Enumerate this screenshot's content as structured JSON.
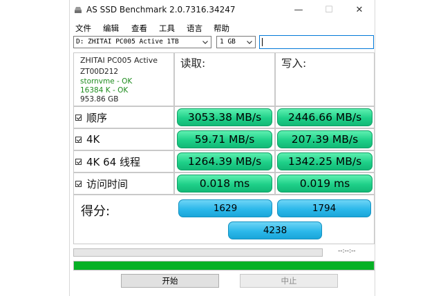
{
  "window": {
    "title": "AS SSD Benchmark 2.0.7316.34247"
  },
  "controls": {
    "minimize": "—",
    "maximize": "☐",
    "close": "✕"
  },
  "menu": [
    "文件",
    "编辑",
    "查看",
    "工具",
    "语言",
    "帮助"
  ],
  "drive": {
    "selected": "D: ZHITAI PC005 Active 1TB"
  },
  "size": {
    "selected": "1 GB"
  },
  "search": {
    "value": ""
  },
  "info": {
    "model": "ZHITAI PC005 Active",
    "firmware": "ZT00D212",
    "driver": "stornvme - OK",
    "alignment": "16384 K - OK",
    "capacity": "953.86 GB"
  },
  "headers": {
    "read": "读取:",
    "write": "写入:"
  },
  "tests": [
    {
      "label": "顺序",
      "read": "3053.38 MB/s",
      "write": "2446.66 MB/s",
      "checked": true
    },
    {
      "label": "4K",
      "read": "59.71 MB/s",
      "write": "207.39 MB/s",
      "checked": true
    },
    {
      "label": "4K 64 线程",
      "read": "1264.39 MB/s",
      "write": "1342.25 MB/s",
      "checked": true
    },
    {
      "label": "访问时间",
      "read": "0.018 ms",
      "write": "0.019 ms",
      "checked": true
    }
  ],
  "score": {
    "label": "得分:",
    "read": "1629",
    "write": "1794",
    "total": "4238"
  },
  "progress": {
    "elapsed": "--:--:--",
    "fraction": 1.0
  },
  "buttons": {
    "start": "开始",
    "stop": "中止"
  },
  "colors": {
    "result_green": "#1fd089",
    "score_blue": "#2cb8ea",
    "progress_green": "#06b025",
    "focus_blue": "#0078d7"
  }
}
